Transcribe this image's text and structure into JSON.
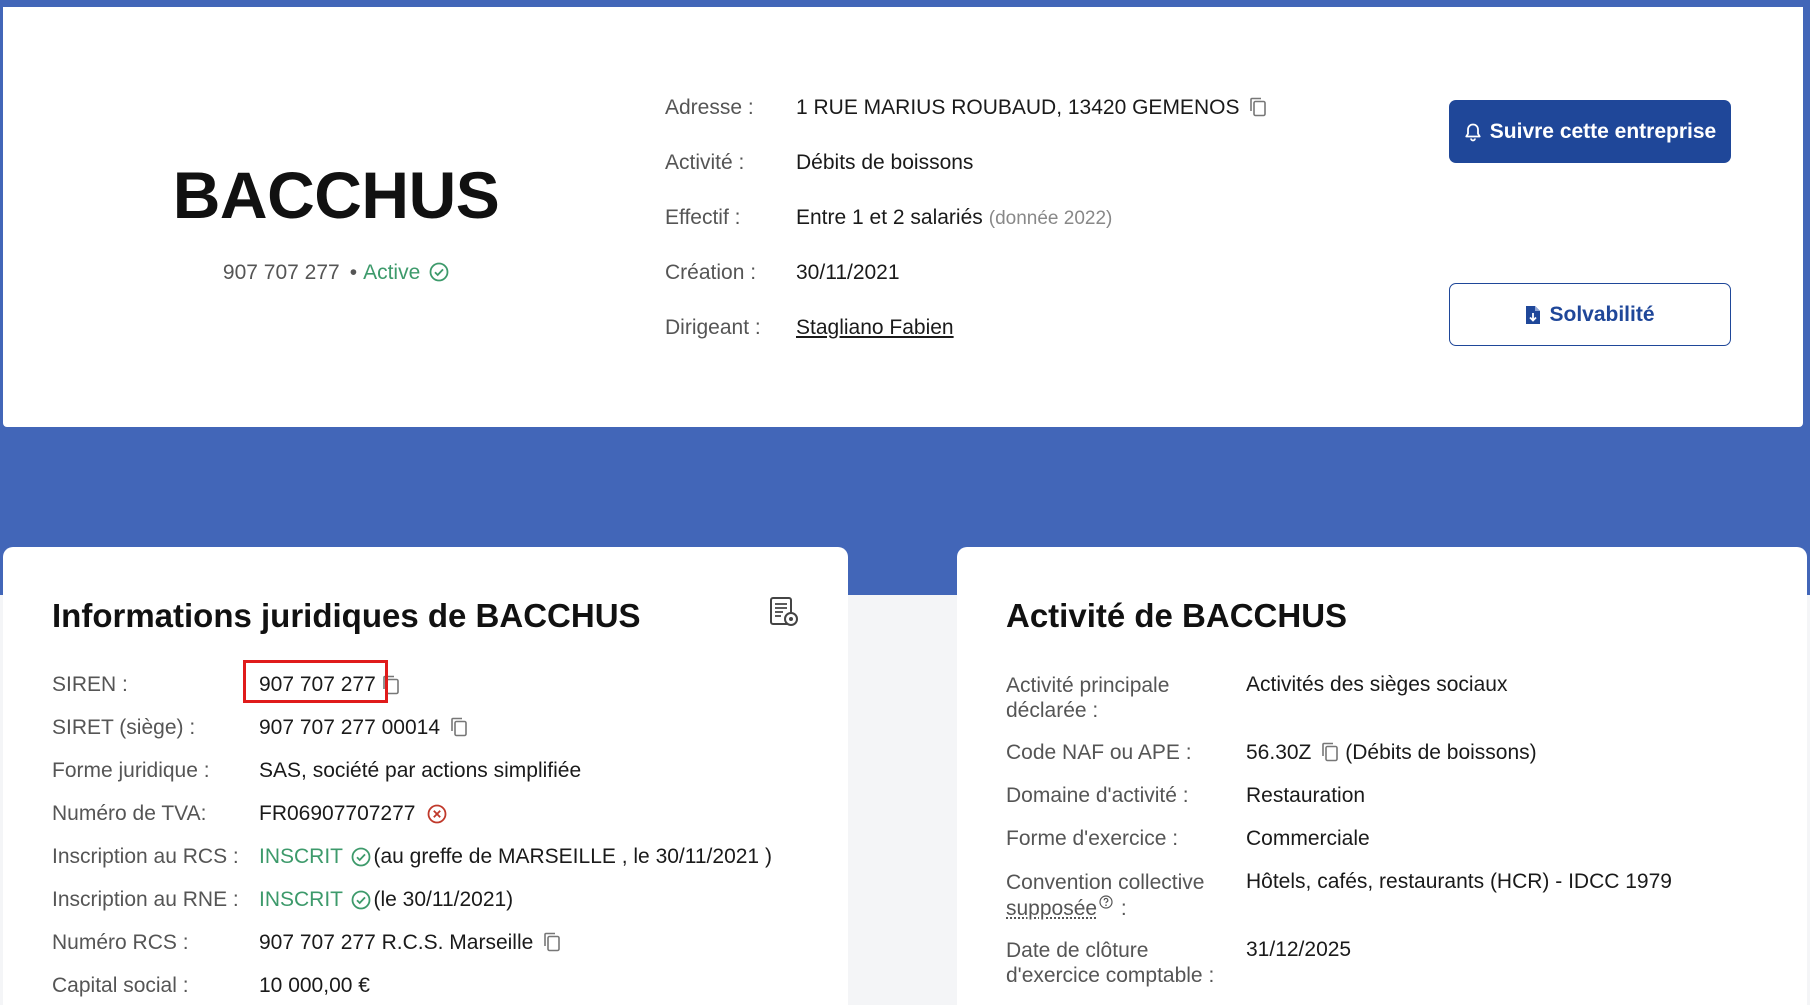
{
  "header": {
    "company_name": "BACCHUS",
    "siren": "907 707 277",
    "dot": "•",
    "status": "Active",
    "address_label": "Adresse :",
    "address": "1 RUE MARIUS ROUBAUD, 13420 GEMENOS",
    "activity_label": "Activité :",
    "activity": "Débits de boissons",
    "staff_label": "Effectif :",
    "staff": "Entre 1 et 2 salariés",
    "staff_note": "(donnée 2022)",
    "creation_label": "Création :",
    "creation": "30/11/2021",
    "director_label": "Dirigeant :",
    "director": "Stagliano Fabien",
    "follow_button": "Suivre cette entreprise",
    "solvency_button": "Solvabilité"
  },
  "legal": {
    "title": "Informations juridiques de BACCHUS",
    "siren_label": "SIREN :",
    "siren": "907 707 277",
    "siret_label": "SIRET (siège) :",
    "siret": "907 707 277 00014",
    "form_label": "Forme juridique :",
    "form": "SAS, société par actions simplifiée",
    "vat_label": "Numéro de TVA:",
    "vat": "FR06907707277",
    "rcs_label": "Inscription au RCS :",
    "rcs_status": "INSCRIT",
    "rcs_detail": "(au greffe de MARSEILLE , le 30/11/2021 )",
    "rne_label": "Inscription au RNE :",
    "rne_status": "INSCRIT",
    "rne_detail": "(le 30/11/2021)",
    "rcs_number_label": "Numéro RCS :",
    "rcs_number": "907 707 277 R.C.S. Marseille",
    "capital_label": "Capital social :",
    "capital": "10 000,00 €"
  },
  "activity": {
    "title": "Activité de BACCHUS",
    "main_label_1": "Activité principale",
    "main_label_2": "déclarée :",
    "main": "Activités des sièges sociaux",
    "naf_label": "Code NAF ou APE :",
    "naf_code": "56.30Z",
    "naf_desc": "(Débits de boissons)",
    "domain_label": "Domaine d'activité :",
    "domain": "Restauration",
    "exercise_label": "Forme d'exercice :",
    "exercise": "Commerciale",
    "convention_label_1": "Convention collective",
    "convention_label_2": "supposée",
    "convention_label_3": ":",
    "convention": "Hôtels, cafés, restaurants (HCR) - IDCC 1979",
    "closing_label_1": "Date de clôture",
    "closing_label_2": "d'exercice comptable :",
    "closing": "31/12/2025"
  },
  "colors": {
    "background": "#4266b8",
    "primary": "#1f4799",
    "success": "#3d9a6b",
    "error": "#c0392b",
    "highlight": "#e01b1b"
  }
}
